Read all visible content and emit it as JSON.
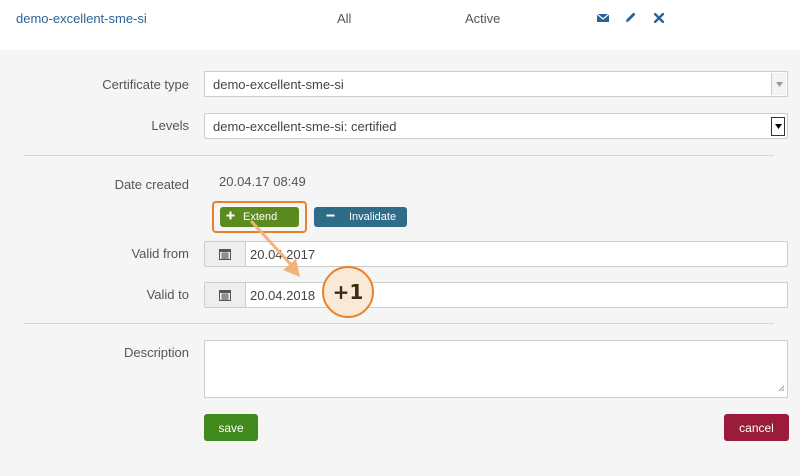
{
  "row": {
    "name": "demo-excellent-sme-si",
    "scope": "All",
    "status": "Active",
    "actions": [
      {
        "icon": "envelope-icon",
        "label": "Send"
      },
      {
        "icon": "pencil-icon",
        "label": "Edit"
      },
      {
        "icon": "close-icon",
        "label": "Delete"
      }
    ]
  },
  "form": {
    "certificate_type": {
      "label": "Certificate type",
      "value": "demo-excellent-sme-si"
    },
    "levels": {
      "label": "Levels",
      "value": "demo-excellent-sme-si: certified"
    },
    "date_created": {
      "label": "Date created",
      "value": "20.04.17 08:49"
    },
    "extend_label": "Extend",
    "invalidate_label": "Invalidate",
    "valid_from": {
      "label": "Valid from",
      "value": "20.04.2017"
    },
    "valid_to": {
      "label": "Valid to",
      "value": "20.04.2018"
    },
    "description": {
      "label": "Description",
      "value": ""
    },
    "save_label": "save",
    "cancel_label": "cancel"
  },
  "annotation": {
    "badge_text": "+1",
    "accent_color": "#e8822a"
  },
  "colors": {
    "extend": "#5b8a1e",
    "invalidate": "#2e6c88",
    "save": "#3f8a1a",
    "cancel": "#9c1b3a",
    "link": "#2a6496"
  }
}
